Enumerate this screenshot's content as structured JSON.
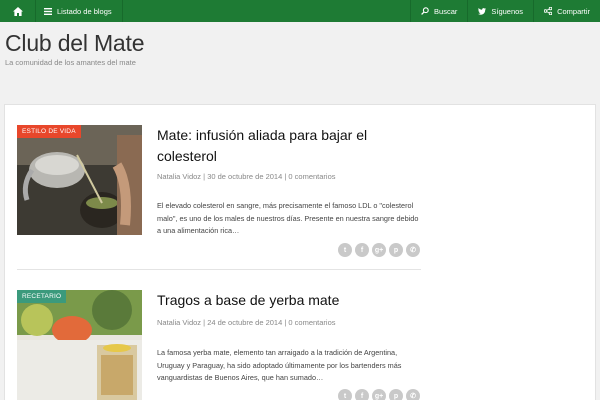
{
  "topbar": {
    "home_icon": "home-icon",
    "blogs_label": "Listado de blogs",
    "search_label": "Buscar",
    "follow_label": "Síguenos",
    "share_label": "Compartir",
    "bg_color": "#1e7b34"
  },
  "header": {
    "title": "Club del Mate",
    "tagline": "La comunidad de los amantes del mate"
  },
  "posts": [
    {
      "badge": "ESTILO DE VIDA",
      "badge_color": "#e8472b",
      "title": "Mate: infusión aliada para bajar el colesterol",
      "author": "Natalia Vidoz",
      "date": "30 de octubre de 2014",
      "comments": "0 comentarios",
      "excerpt": "El elevado colesterol en sangre, más precisamente el famoso LDL o \"colesterol malo\", es uno de los males de nuestros días. Presente en nuestra sangre debido a una alimentación rica…"
    },
    {
      "badge": "RECETARIO",
      "badge_color": "#3b9a7c",
      "title": "Tragos a base de yerba mate",
      "author": "Natalia Vidoz",
      "date": "24 de octubre de 2014",
      "comments": "0 comentarios",
      "excerpt": "La famosa yerba mate, elemento tan arraigado a la tradición de Argentina, Uruguay y Paraguay, ha sido adoptado últimamente por los bartenders más vanguardistas de Buenos Aires, que han sumado…"
    }
  ],
  "share_icons": [
    "twitter-icon",
    "facebook-icon",
    "google-plus-icon",
    "pinterest-icon",
    "whatsapp-icon"
  ],
  "meta_separator": "|"
}
